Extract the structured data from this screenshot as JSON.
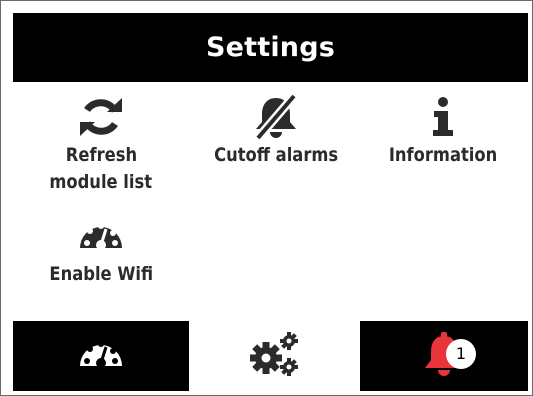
{
  "header": {
    "title": "Settings"
  },
  "tiles": [
    {
      "id": "refresh",
      "icon": "refresh-icon",
      "label_line1": "Refresh",
      "label_line2": "module list"
    },
    {
      "id": "cutoff",
      "icon": "bell-slash-icon",
      "label": "Cutoff alarms"
    },
    {
      "id": "info",
      "icon": "info-icon",
      "label": "Information"
    },
    {
      "id": "wifi",
      "icon": "gauge-icon",
      "label": "Enable Wifi"
    }
  ],
  "nav": {
    "tabs": [
      {
        "name": "dashboard",
        "icon": "gauge-icon",
        "active": false
      },
      {
        "name": "settings",
        "icon": "gears-icon",
        "active": true
      },
      {
        "name": "alarms",
        "icon": "bell-icon",
        "active": false,
        "badge": "1"
      }
    ]
  },
  "colors": {
    "bar_background": "#000000",
    "text": "#2b2b2b",
    "alarm_bell": "#e8343a"
  }
}
